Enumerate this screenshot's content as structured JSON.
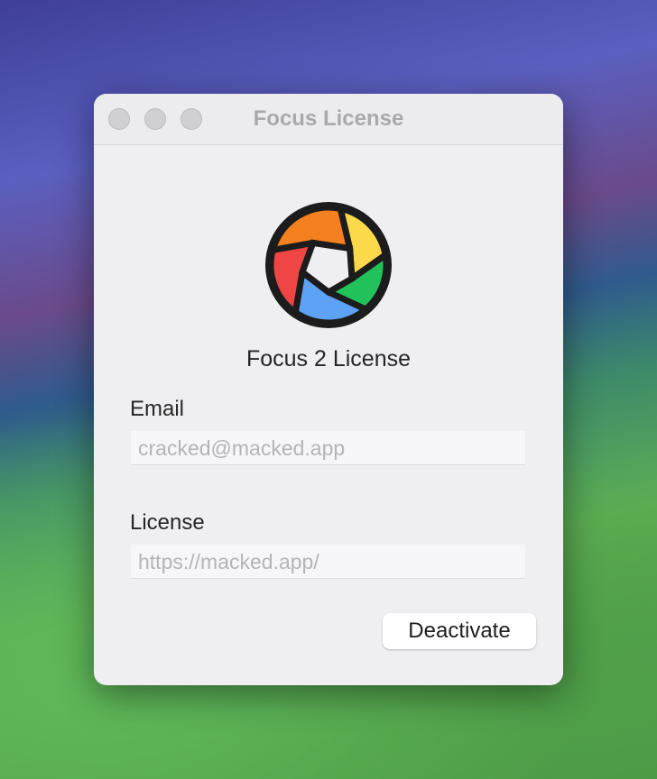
{
  "window": {
    "title": "Focus License"
  },
  "app": {
    "name": "Focus 2 License"
  },
  "form": {
    "email_label": "Email",
    "email_value": "cracked@macked.app",
    "license_label": "License",
    "license_value": "https://macked.app/"
  },
  "buttons": {
    "deactivate": "Deactivate"
  },
  "colors": {
    "orange": "#f5801f",
    "yellow": "#fbd94a",
    "green": "#22c25a",
    "blue": "#5ea2f6",
    "red": "#ef4545"
  }
}
